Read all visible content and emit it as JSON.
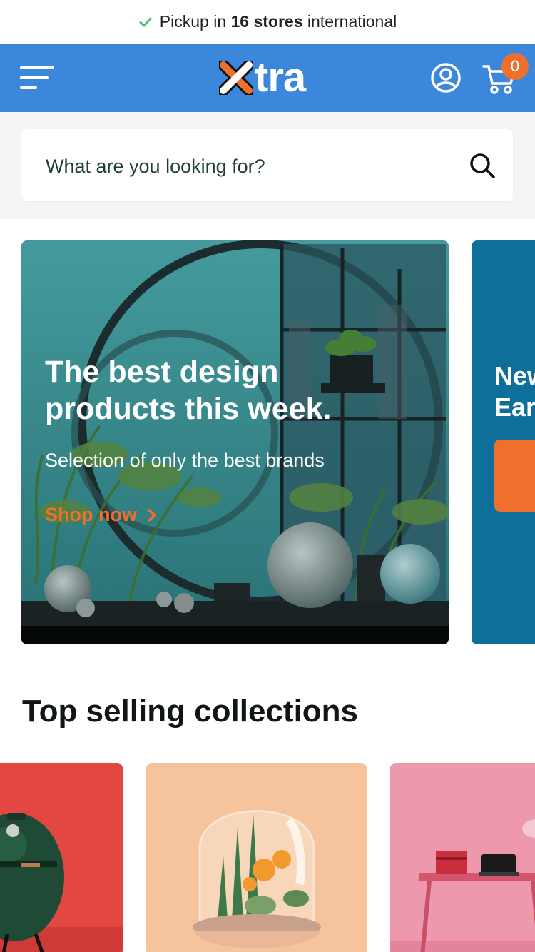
{
  "announcement": {
    "prefix": "Pickup in",
    "highlight": "16 stores",
    "suffix": "international",
    "icon": "check-icon",
    "icon_color": "#4dbd74"
  },
  "header": {
    "logo_text": "tra",
    "logo_mark": "x",
    "menu_icon": "hamburger-menu-icon",
    "account_icon": "account-icon",
    "cart_icon": "cart-icon",
    "cart_count": "0",
    "background": "#3a87db",
    "accent": "#ef6f2c"
  },
  "search": {
    "placeholder": "What are you looking for?",
    "value": "",
    "icon": "search-icon"
  },
  "hero_slides": [
    {
      "title": "The best design products this week.",
      "subtitle": "Selection of only the best brands",
      "link_label": "Shop now",
      "link_icon": "chevron-right-icon"
    },
    {
      "title_line1": "New",
      "title_line2": "Ear"
    }
  ],
  "sections": {
    "top_selling": {
      "title": "Top selling collections",
      "collections": [
        {
          "image": "kamado-grill-red-background"
        },
        {
          "image": "terrarium-plants-peach-background"
        },
        {
          "image": "desk-pink-background"
        }
      ]
    }
  }
}
